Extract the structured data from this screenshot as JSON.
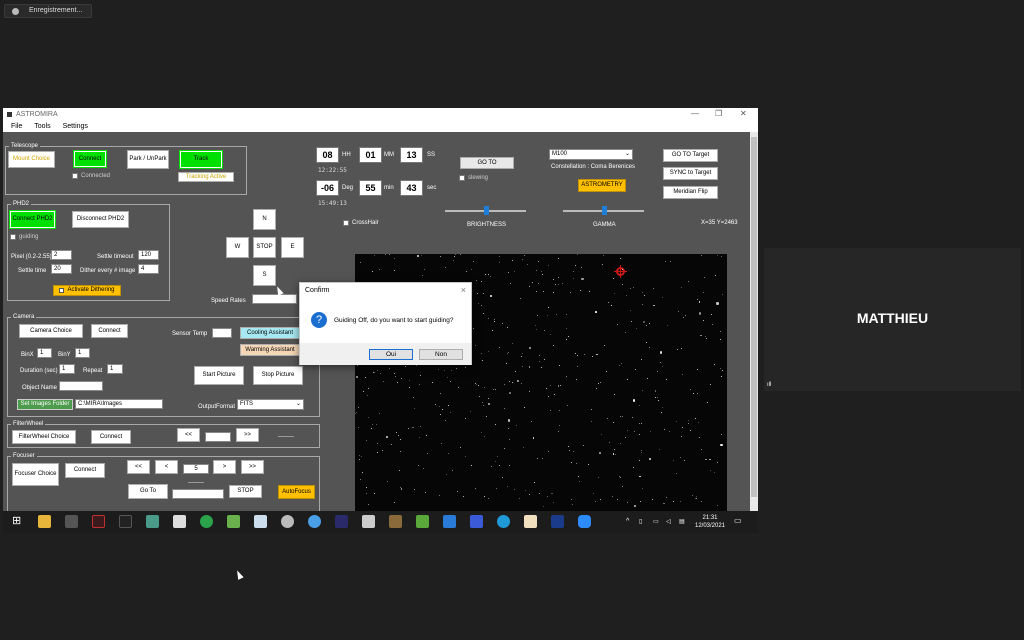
{
  "recording": {
    "label": "Enregistrement..."
  },
  "app": {
    "title": "ASTROMIRA",
    "menu": [
      "File",
      "Tools",
      "Settings"
    ]
  },
  "telescope": {
    "group": "Telescope",
    "mount_choice": "Mount Choice",
    "connect": "Connect",
    "connected": "Connected",
    "park": "Park / UnPark",
    "track": "Track",
    "tracking_active": "Tracking Active"
  },
  "phd2": {
    "group": "PHD2",
    "connect": "Connect PHD2",
    "disconnect": "Disconnect PHD2",
    "guiding": "guiding",
    "pixel_label": "Pixel (0.2-2.55)",
    "pixel_value": "2",
    "settle_timeout_label": "Settle timeout",
    "settle_timeout_value": "120",
    "settle_time_label": "Settle time",
    "settle_time_value": "20",
    "dither_label": "Dither every # image",
    "dither_value": "4",
    "activate_dithering": "Activate Dithering"
  },
  "nav": {
    "n": "N",
    "w": "W",
    "stop": "STOP",
    "e": "E",
    "s": "S",
    "speed_rates": "Speed Rates"
  },
  "coords": {
    "ra_h": "08",
    "ra_h_lbl": "HH",
    "ra_m": "01",
    "ra_m_lbl": "MM",
    "ra_s": "13",
    "ra_s_lbl": "SS",
    "ra_text": "12:22:55",
    "dec_d": "-06",
    "dec_d_lbl": "Deg",
    "dec_m": "55",
    "dec_m_lbl": "min",
    "dec_s": "43",
    "dec_s_lbl": "sec",
    "dec_text": "15:49:13",
    "crosshair": "CrossHair"
  },
  "goto": {
    "goto": "GO TO",
    "slewing": "slewing",
    "brightness": "BRIGHTNESS",
    "gamma": "GAMMA",
    "brightness_level": 0.5,
    "gamma_level": 0.5
  },
  "target": {
    "object": "M100",
    "constellation": "Constellation : Coma Berenices",
    "astrometry": "ASTROMETRY",
    "goto_target": "GO TO Target",
    "sync_target": "SYNC to Target",
    "meridian_flip": "Meridian Flip",
    "xy": "X=35 Y=2463"
  },
  "camera": {
    "group": "Camera",
    "choice": "Camera Choice",
    "connect": "Connect",
    "sensor_temp": "Sensor Temp",
    "cooling": "Cooling Assistant",
    "warming": "Warming Assistant",
    "binx_label": "BinX",
    "binx": "1",
    "biny_label": "BinY",
    "biny": "1",
    "duration_label": "Duration (sec)",
    "duration": "1",
    "repeat_label": "Repeat",
    "repeat": "1",
    "object_label": "Object Name",
    "start": "Start Picture",
    "stop": "Stop Picture",
    "images_folder": "Set Images Folder",
    "folder_path": "C:\\MIRA\\Images",
    "output_label": "OutputFormat",
    "output_format": "FITS"
  },
  "filterwheel": {
    "group": "FilterWheel",
    "choice": "FilterWheel Choice",
    "connect": "Connect",
    "prev": "<<",
    "next": ">>",
    "status": "--------"
  },
  "focuser": {
    "group": "Focuser",
    "choice": "Focuser Choice",
    "connect": "Connect",
    "ll": "<<",
    "l": "<",
    "value": "5",
    "r": ">",
    "rr": ">>",
    "dashes": "--------",
    "goto": "Go To",
    "stop": "STOP",
    "autofocus": "AutoFocus"
  },
  "dialog": {
    "title": "Confirm",
    "message": "Guiding Off, do you want to start guiding?",
    "yes": "Oui",
    "no": "Non"
  },
  "taskbar": {
    "time": "21:31",
    "date": "12/03/2021"
  },
  "participant": {
    "name": "MATTHIEU"
  }
}
